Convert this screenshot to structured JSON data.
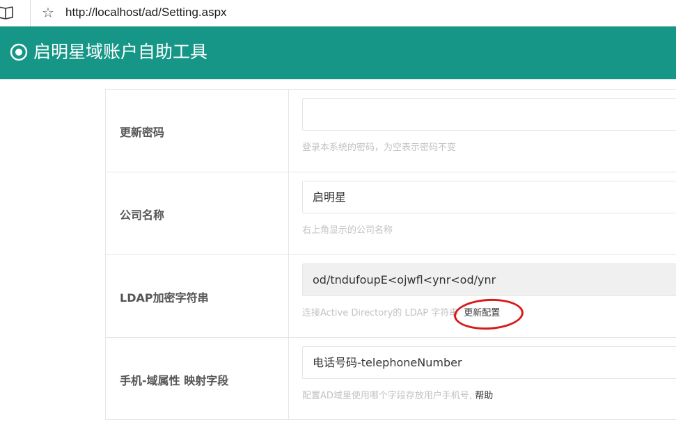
{
  "browser": {
    "url": "http://localhost/ad/Setting.aspx",
    "reader_icon": "book-icon",
    "favorite_icon": "star-icon"
  },
  "header": {
    "title": "启明星域账户自助工具",
    "logo_icon": "radio-circle-icon",
    "bg_color": "#159687"
  },
  "form": {
    "password": {
      "label": "更新密码",
      "value": "",
      "hint": "登录本系统的密码，为空表示密码不变"
    },
    "company": {
      "label": "公司名称",
      "value": "启明星",
      "hint": "右上角显示的公司名称"
    },
    "ldap": {
      "label": "LDAP加密字符串",
      "value": "od/tndufoupE<ojwfl<ynr<od/ynr",
      "hint": "连接Active Directory的 LDAP 字符串",
      "action_label": "更新配置"
    },
    "mobile": {
      "label": "手机-域属性 映射字段",
      "value": "电话号码-telephoneNumber",
      "hint": "配置AD域里使用哪个字段存放用户手机号,",
      "help_label": "帮助"
    }
  }
}
